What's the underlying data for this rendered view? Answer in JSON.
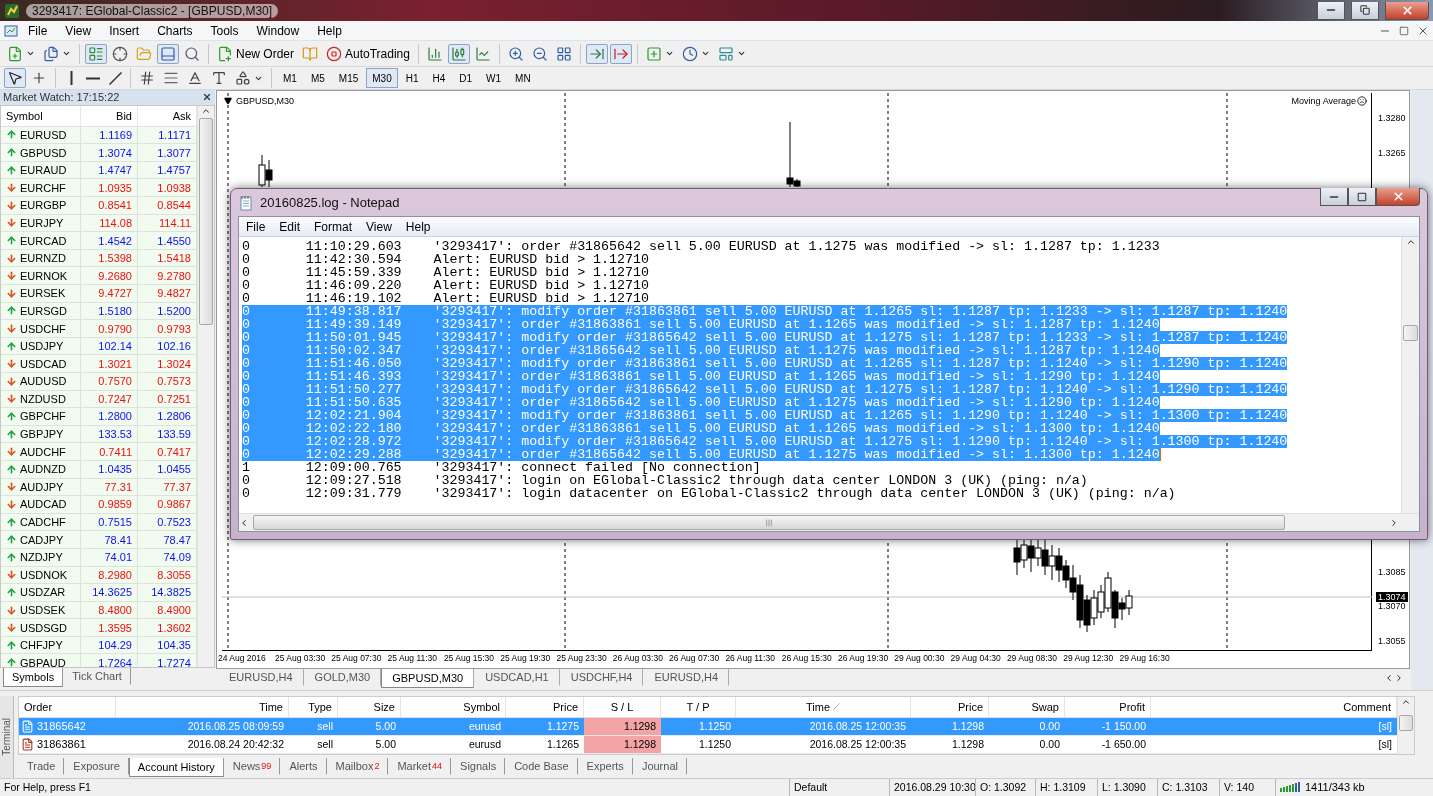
{
  "window": {
    "title": "3293417: EGlobal-Classic2 - [GBPUSD,M30]"
  },
  "menu": [
    "File",
    "View",
    "Insert",
    "Charts",
    "Tools",
    "Window",
    "Help"
  ],
  "toolbar": [
    {
      "pressed": false
    },
    {
      "pressed": false
    },
    {
      "pressed": true
    },
    {
      "pressed": false
    },
    {
      "pressed": false
    },
    {
      "pressed": true
    },
    {
      "pressed": false
    },
    {
      "pressed": false,
      "label": "New Order"
    },
    {
      "pressed": false
    },
    {
      "pressed": false,
      "label": "AutoTrading"
    },
    {
      "pressed": false
    },
    {
      "pressed": true
    },
    {
      "pressed": false
    },
    {
      "pressed": false
    },
    {
      "pressed": false
    },
    {
      "pressed": false
    },
    {
      "pressed": true
    },
    {
      "pressed": true
    },
    {
      "pressed": false
    },
    {
      "pressed": false
    },
    {
      "pressed": false
    }
  ],
  "drawing_toolbar": [
    {
      "pressed": true
    },
    {
      "pressed": false
    },
    {
      "pressed": false
    },
    {
      "pressed": false
    },
    {
      "pressed": false
    },
    {
      "pressed": false
    },
    {
      "pressed": false
    },
    {
      "pressed": false
    },
    {
      "pressed": false
    },
    {
      "pressed": false
    }
  ],
  "timeframes": [
    {
      "label": "M1",
      "selected": false
    },
    {
      "label": "M5",
      "selected": false
    },
    {
      "label": "M15",
      "selected": false
    },
    {
      "label": "M30",
      "selected": true
    },
    {
      "label": "H1",
      "selected": false
    },
    {
      "label": "H4",
      "selected": false
    },
    {
      "label": "D1",
      "selected": false
    },
    {
      "label": "W1",
      "selected": false
    },
    {
      "label": "MN",
      "selected": false
    }
  ],
  "market_watch": {
    "title": "Market Watch: 17:15:22",
    "columns": [
      "Symbol",
      "Bid",
      "Ask"
    ],
    "rows": [
      {
        "symbol": "EURUSD",
        "bid": "1.1169",
        "ask": "1.1171",
        "rising": true
      },
      {
        "symbol": "GBPUSD",
        "bid": "1.3074",
        "ask": "1.3077",
        "rising": true
      },
      {
        "symbol": "EURAUD",
        "bid": "1.4747",
        "ask": "1.4757",
        "rising": true
      },
      {
        "symbol": "EURCHF",
        "bid": "1.0935",
        "ask": "1.0938",
        "rising": false
      },
      {
        "symbol": "EURGBP",
        "bid": "0.8541",
        "ask": "0.8544",
        "rising": false
      },
      {
        "symbol": "EURJPY",
        "bid": "114.08",
        "ask": "114.11",
        "rising": false
      },
      {
        "symbol": "EURCAD",
        "bid": "1.4542",
        "ask": "1.4550",
        "rising": true
      },
      {
        "symbol": "EURNZD",
        "bid": "1.5398",
        "ask": "1.5418",
        "rising": false
      },
      {
        "symbol": "EURNOK",
        "bid": "9.2680",
        "ask": "9.2780",
        "rising": false
      },
      {
        "symbol": "EURSEK",
        "bid": "9.4727",
        "ask": "9.4827",
        "rising": false
      },
      {
        "symbol": "EURSGD",
        "bid": "1.5180",
        "ask": "1.5200",
        "rising": true
      },
      {
        "symbol": "USDCHF",
        "bid": "0.9790",
        "ask": "0.9793",
        "rising": false
      },
      {
        "symbol": "USDJPY",
        "bid": "102.14",
        "ask": "102.16",
        "rising": true
      },
      {
        "symbol": "USDCAD",
        "bid": "1.3021",
        "ask": "1.3024",
        "rising": false
      },
      {
        "symbol": "AUDUSD",
        "bid": "0.7570",
        "ask": "0.7573",
        "rising": false
      },
      {
        "symbol": "NZDUSD",
        "bid": "0.7247",
        "ask": "0.7251",
        "rising": false
      },
      {
        "symbol": "GBPCHF",
        "bid": "1.2800",
        "ask": "1.2806",
        "rising": true
      },
      {
        "symbol": "GBPJPY",
        "bid": "133.53",
        "ask": "133.59",
        "rising": true
      },
      {
        "symbol": "AUDCHF",
        "bid": "0.7411",
        "ask": "0.7417",
        "rising": false
      },
      {
        "symbol": "AUDNZD",
        "bid": "1.0435",
        "ask": "1.0455",
        "rising": true
      },
      {
        "symbol": "AUDJPY",
        "bid": "77.31",
        "ask": "77.37",
        "rising": false
      },
      {
        "symbol": "AUDCAD",
        "bid": "0.9859",
        "ask": "0.9867",
        "rising": false
      },
      {
        "symbol": "CADCHF",
        "bid": "0.7515",
        "ask": "0.7523",
        "rising": true
      },
      {
        "symbol": "CADJPY",
        "bid": "78.41",
        "ask": "78.47",
        "rising": true
      },
      {
        "symbol": "NZDJPY",
        "bid": "74.01",
        "ask": "74.09",
        "rising": true
      },
      {
        "symbol": "USDNOK",
        "bid": "8.2980",
        "ask": "8.3055",
        "rising": false
      },
      {
        "symbol": "USDZAR",
        "bid": "14.3625",
        "ask": "14.3825",
        "rising": true
      },
      {
        "symbol": "USDSEK",
        "bid": "8.4800",
        "ask": "8.4900",
        "rising": false
      },
      {
        "symbol": "USDSGD",
        "bid": "1.3595",
        "ask": "1.3602",
        "rising": false
      },
      {
        "symbol": "CHFJPY",
        "bid": "104.29",
        "ask": "104.35",
        "rising": true
      },
      {
        "symbol": "GBPAUD",
        "bid": "1.7264",
        "ask": "1.7274",
        "rising": true
      }
    ],
    "tabs": [
      {
        "label": "Symbols",
        "selected": true
      },
      {
        "label": "Tick Chart",
        "selected": false
      }
    ]
  },
  "chart": {
    "title": "GBPUSD,M30",
    "indicator": "Moving Average",
    "price_labels": [
      "1.3280",
      "1.3265",
      "1.3085",
      "1.3070",
      "1.3055"
    ],
    "current_price": "1.3074",
    "time_labels": [
      "24 Aug 2016",
      "25 Aug 03:30",
      "25 Aug 07:30",
      "25 Aug 11:30",
      "25 Aug 15:30",
      "25 Aug 19:30",
      "25 Aug 23:30",
      "26 Aug 03:30",
      "26 Aug 07:30",
      "26 Aug 11:30",
      "26 Aug 15:30",
      "26 Aug 19:30",
      "29 Aug 00:30",
      "29 Aug 04:30",
      "29 Aug 08:30",
      "29 Aug 12:30",
      "29 Aug 16:30"
    ]
  },
  "chart_tabs": [
    {
      "label": "EURUSD,H4",
      "selected": false
    },
    {
      "label": "GOLD,M30",
      "selected": false
    },
    {
      "label": "GBPUSD,M30",
      "selected": true
    },
    {
      "label": "USDCAD,H1",
      "selected": false
    },
    {
      "label": "USDCHF,H4",
      "selected": false
    },
    {
      "label": "EURUSD,H4",
      "selected": false
    }
  ],
  "notepad": {
    "title": "20160825.log - Notepad",
    "menu": [
      "File",
      "Edit",
      "Format",
      "View",
      "Help"
    ],
    "lines": [
      {
        "level": "0",
        "time": "11:10:29.603",
        "message": "'3293417': order #31865642 sell 5.00 EURUSD at 1.1275 was modified -> sl: 1.1287 tp: 1.1233",
        "selected": false
      },
      {
        "level": "0",
        "time": "11:42:30.594",
        "message": "Alert: EURUSD bid > 1.12710",
        "selected": false
      },
      {
        "level": "0",
        "time": "11:45:59.339",
        "message": "Alert: EURUSD bid > 1.12710",
        "selected": false
      },
      {
        "level": "0",
        "time": "11:46:09.220",
        "message": "Alert: EURUSD bid > 1.12710",
        "selected": false
      },
      {
        "level": "0",
        "time": "11:46:19.102",
        "message": "Alert: EURUSD bid > 1.12710",
        "selected": false
      },
      {
        "level": "0",
        "time": "11:49:38.817",
        "message": "'3293417': modify order #31863861 sell 5.00 EURUSD at 1.1265 sl: 1.1287 tp: 1.1233 -> sl: 1.1287 tp: 1.1240",
        "selected": true
      },
      {
        "level": "0",
        "time": "11:49:39.149",
        "message": "'3293417': order #31863861 sell 5.00 EURUSD at 1.1265 was modified -> sl: 1.1287 tp: 1.1240",
        "selected": true
      },
      {
        "level": "0",
        "time": "11:50:01.945",
        "message": "'3293417': modify order #31865642 sell 5.00 EURUSD at 1.1275 sl: 1.1287 tp: 1.1233 -> sl: 1.1287 tp: 1.1240",
        "selected": true
      },
      {
        "level": "0",
        "time": "11:50:02.347",
        "message": "'3293417': order #31865642 sell 5.00 EURUSD at 1.1275 was modified -> sl: 1.1287 tp: 1.1240",
        "selected": true
      },
      {
        "level": "0",
        "time": "11:51:46.050",
        "message": "'3293417': modify order #31863861 sell 5.00 EURUSD at 1.1265 sl: 1.1287 tp: 1.1240 -> sl: 1.1290 tp: 1.1240",
        "selected": true
      },
      {
        "level": "0",
        "time": "11:51:46.393",
        "message": "'3293417': order #31863861 sell 5.00 EURUSD at 1.1265 was modified -> sl: 1.1290 tp: 1.1240",
        "selected": true
      },
      {
        "level": "0",
        "time": "11:51:50.277",
        "message": "'3293417': modify order #31865642 sell 5.00 EURUSD at 1.1275 sl: 1.1287 tp: 1.1240 -> sl: 1.1290 tp: 1.1240",
        "selected": true
      },
      {
        "level": "0",
        "time": "11:51:50.635",
        "message": "'3293417': order #31865642 sell 5.00 EURUSD at 1.1275 was modified -> sl: 1.1290 tp: 1.1240",
        "selected": true
      },
      {
        "level": "0",
        "time": "12:02:21.904",
        "message": "'3293417': modify order #31863861 sell 5.00 EURUSD at 1.1265 sl: 1.1290 tp: 1.1240 -> sl: 1.1300 tp: 1.1240",
        "selected": true
      },
      {
        "level": "0",
        "time": "12:02:22.180",
        "message": "'3293417': order #31863861 sell 5.00 EURUSD at 1.1265 was modified -> sl: 1.1300 tp: 1.1240",
        "selected": true
      },
      {
        "level": "0",
        "time": "12:02:28.972",
        "message": "'3293417': modify order #31865642 sell 5.00 EURUSD at 1.1275 sl: 1.1290 tp: 1.1240 -> sl: 1.1300 tp: 1.1240",
        "selected": true
      },
      {
        "level": "0",
        "time": "12:02:29.288",
        "message": "'3293417': order #31865642 sell 5.00 EURUSD at 1.1275 was modified -> sl: 1.1300 tp: 1.1240",
        "selected": true
      },
      {
        "level": "1",
        "time": "12:09:00.765",
        "message": "'3293417': connect failed [No connection]",
        "selected": false
      },
      {
        "level": "0",
        "time": "12:09:27.518",
        "message": "'3293417': login on EGlobal-Classic2 through data center LONDON 3 (UK) (ping: n/a)",
        "selected": false
      },
      {
        "level": "0",
        "time": "12:09:31.779",
        "message": "'3293417': login datacenter on EGlobal-Classic2 through data center LONDON 3 (UK) (ping: n/a)",
        "selected": false
      }
    ]
  },
  "terminal": {
    "side_label": "Terminal",
    "columns": [
      {
        "label": "Order",
        "sorted": false
      },
      {
        "label": "Time",
        "sorted": false
      },
      {
        "label": "Type",
        "sorted": false
      },
      {
        "label": "Size",
        "sorted": false
      },
      {
        "label": "Symbol",
        "sorted": false
      },
      {
        "label": "Price",
        "sorted": false
      },
      {
        "label": "S / L",
        "sorted": false
      },
      {
        "label": "T / P",
        "sorted": false
      },
      {
        "label": "Time",
        "sorted": true
      },
      {
        "label": "Price",
        "sorted": false
      },
      {
        "label": "Swap",
        "sorted": false
      },
      {
        "label": "Profit",
        "sorted": false
      },
      {
        "label": "Comment",
        "sorted": false
      }
    ],
    "rows": [
      {
        "order": "31865642",
        "open_time": "2016.08.25 08:09:59",
        "type": "sell",
        "size": "5.00",
        "symbol": "eurusd",
        "price": "1.1275",
        "sl": "1.1298",
        "tp": "1.1250",
        "close_time": "2016.08.25 12:00:35",
        "close_price": "1.1298",
        "swap": "0.00",
        "profit": "-1 150.00",
        "comment": "[sl]",
        "selected": true,
        "sl_hit": true
      },
      {
        "order": "31863861",
        "open_time": "2016.08.24 20:42:32",
        "type": "sell",
        "size": "5.00",
        "symbol": "eurusd",
        "price": "1.1265",
        "sl": "1.1298",
        "tp": "1.1250",
        "close_time": "2016.08.25 12:00:35",
        "close_price": "1.1298",
        "swap": "0.00",
        "profit": "-1 650.00",
        "comment": "[sl]",
        "selected": false,
        "sl_hit": true
      }
    ],
    "tabs": [
      {
        "label": "Trade",
        "selected": false
      },
      {
        "label": "Exposure",
        "selected": false
      },
      {
        "label": "Account History",
        "selected": true
      },
      {
        "label": "News",
        "count": "99",
        "selected": false
      },
      {
        "label": "Alerts",
        "selected": false
      },
      {
        "label": "Mailbox",
        "count": "2",
        "selected": false
      },
      {
        "label": "Market",
        "count": "44",
        "selected": false
      },
      {
        "label": "Signals",
        "selected": false
      },
      {
        "label": "Code Base",
        "selected": false
      },
      {
        "label": "Experts",
        "selected": false
      },
      {
        "label": "Journal",
        "selected": false
      }
    ]
  },
  "status_bar": {
    "help": "For Help, press F1",
    "profile": "Default",
    "datetime": "2016.08.29 10:30",
    "open": "O: 1.3092",
    "high": "H: 1.3109",
    "low": "L: 1.3090",
    "close": "C: 1.3103",
    "volume": "V: 140",
    "traffic": "1411/343 kb"
  }
}
